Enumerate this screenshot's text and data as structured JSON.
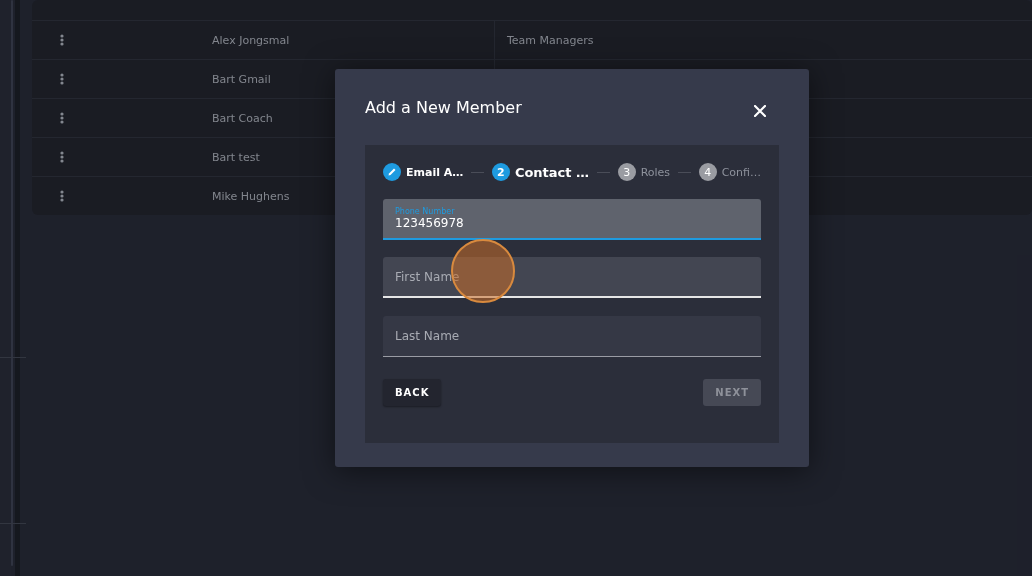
{
  "table": {
    "rows": [
      {
        "name": "Alex Jongsmal",
        "role": "Team Managers"
      },
      {
        "name": "Bart Gmail"
      },
      {
        "name": "Bart Coach"
      },
      {
        "name": "Bart test"
      },
      {
        "name": "Mike Hughens"
      }
    ]
  },
  "dialog": {
    "title": "Add a New Member",
    "steps": [
      {
        "label": "Email A…",
        "completed": true,
        "selected": false
      },
      {
        "number": "2",
        "label": "Contact …",
        "completed": false,
        "selected": true
      },
      {
        "number": "3",
        "label": "Roles",
        "completed": false,
        "selected": false
      },
      {
        "number": "4",
        "label": "Confi…",
        "completed": false,
        "selected": false
      }
    ],
    "fields": [
      {
        "label": "Phone Number",
        "value": "123456978",
        "focused": true,
        "hovered": false
      },
      {
        "placeholder": "First Name",
        "focused": false,
        "hovered": true
      },
      {
        "placeholder": "Last Name",
        "focused": false,
        "hovered": false
      }
    ],
    "back_button": {
      "label": "BACK",
      "disabled": false
    },
    "next_button": {
      "label": "NEXT",
      "disabled": true
    }
  }
}
